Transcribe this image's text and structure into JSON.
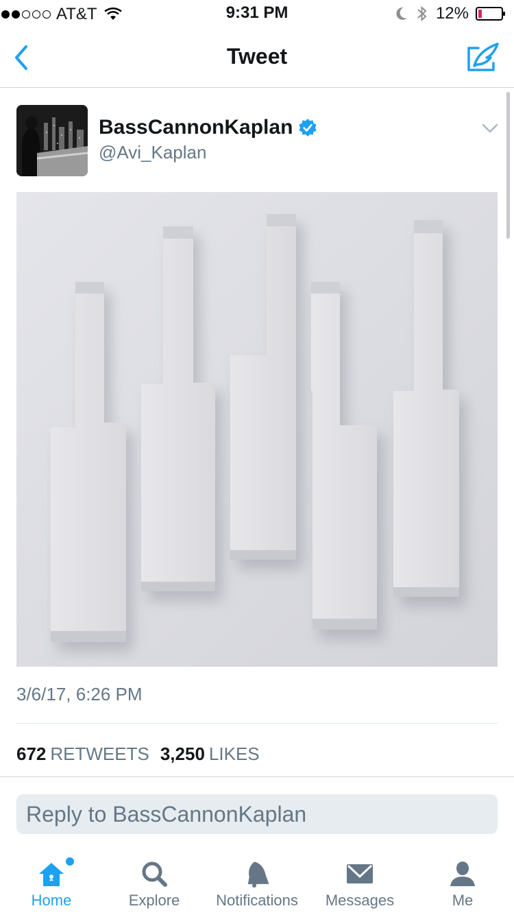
{
  "status_bar": {
    "carrier": "AT&T",
    "time": "9:31 PM",
    "battery": "12%",
    "signal_strength": 2
  },
  "nav": {
    "title": "Tweet",
    "back_icon": "chevron-left-icon",
    "compose_icon": "compose-icon"
  },
  "tweet": {
    "display_name": "BassCannonKaplan",
    "handle": "@Avi_Kaplan",
    "verified": true,
    "timestamp": "3/6/17, 6:26 PM",
    "retweets_count": "672",
    "retweets_label": "RETWEETS",
    "likes_count": "3,250",
    "likes_label": "LIKES"
  },
  "reply": {
    "placeholder": "Reply to BassCannonKaplan"
  },
  "tabs": [
    {
      "label": "Home",
      "icon": "home-icon"
    },
    {
      "label": "Explore",
      "icon": "search-icon"
    },
    {
      "label": "Notifications",
      "icon": "bell-icon"
    },
    {
      "label": "Messages",
      "icon": "envelope-icon"
    },
    {
      "label": "Me",
      "icon": "person-icon"
    }
  ],
  "colors": {
    "accent": "#1da1f2",
    "muted": "#657786",
    "battery_low": "#e0245e"
  }
}
